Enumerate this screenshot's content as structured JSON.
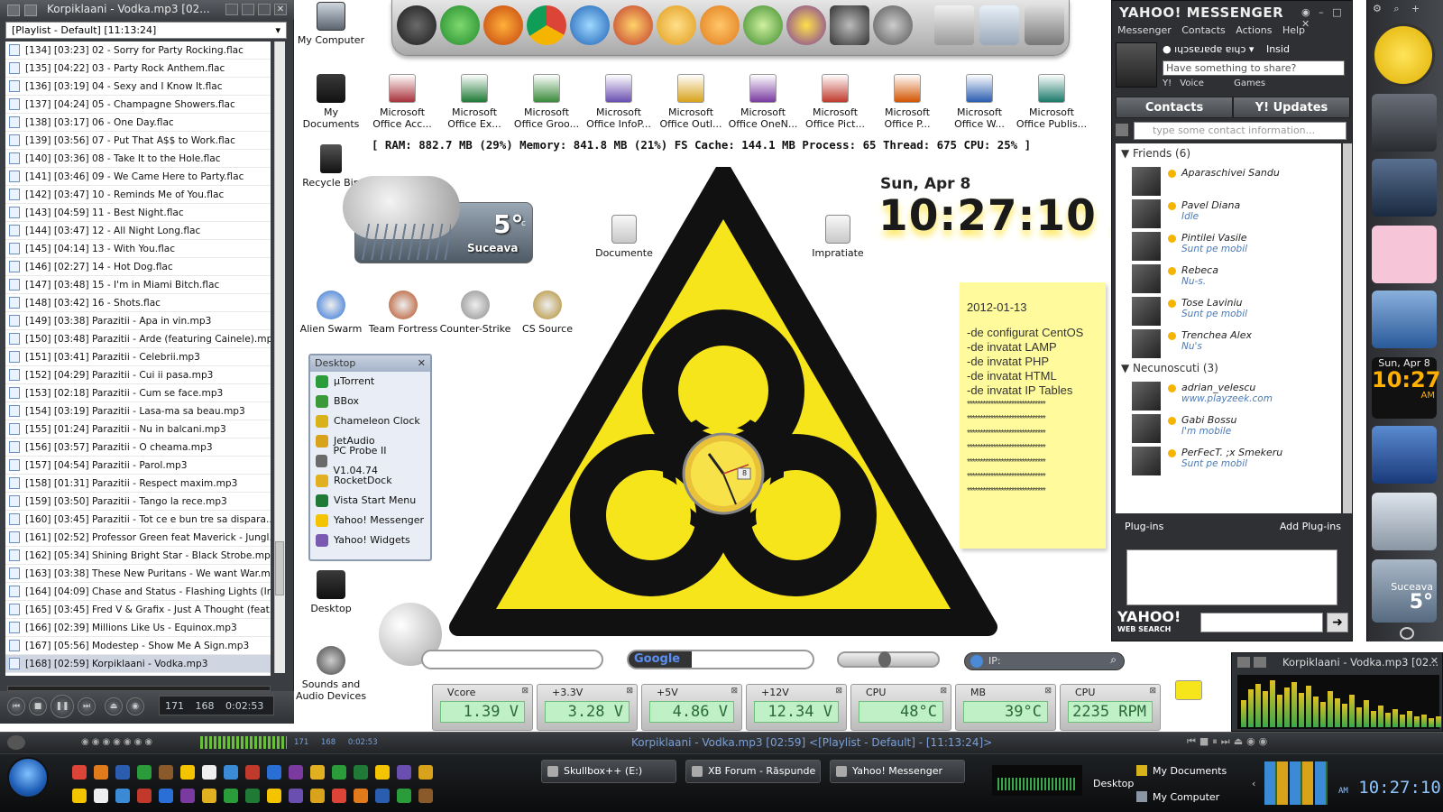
{
  "winamp": {
    "title": "Korpiklaani - Vodka.mp3 [02...",
    "playlist_name": "[Playlist - Default] [11:13:24]",
    "tracks": [
      "[134] [03:23] 02 - Sorry for Party Rocking.flac",
      "[135] [04:22] 03 - Party Rock Anthem.flac",
      "[136] [03:19] 04 - Sexy and I Know It.flac",
      "[137] [04:24] 05 - Champagne Showers.flac",
      "[138] [03:17] 06 - One Day.flac",
      "[139] [03:56] 07 - Put That A$$ to Work.flac",
      "[140] [03:36] 08 - Take It to the Hole.flac",
      "[141] [03:46] 09 - We Came Here to Party.flac",
      "[142] [03:47] 10 - Reminds Me of You.flac",
      "[143] [04:59] 11 - Best Night.flac",
      "[144] [03:47] 12 - All Night Long.flac",
      "[145] [04:14] 13 - With You.flac",
      "[146] [02:27] 14 - Hot Dog.flac",
      "[147] [03:48] 15 - I'm in Miami Bitch.flac",
      "[148] [03:42] 16 - Shots.flac",
      "[149] [03:38] Parazitii - Apa in vin.mp3",
      "[150] [03:48] Parazitii - Arde (featuring Cainele).mp3",
      "[151] [03:41] Parazitii - Celebrii.mp3",
      "[152] [04:29] Parazitii - Cui ii pasa.mp3",
      "[153] [02:18] Parazitii - Cum se face.mp3",
      "[154] [03:19] Parazitii - Lasa-ma sa beau.mp3",
      "[155] [01:24] Parazitii - Nu in balcani.mp3",
      "[156] [03:57] Parazitii - O cheama.mp3",
      "[157] [04:54] Parazitii - Parol.mp3",
      "[158] [01:31] Parazitii - Respect maxim.mp3",
      "[159] [03:50] Parazitii - Tango la rece.mp3",
      "[160] [03:45] Parazitii - Tot ce e bun tre sa dispara....",
      "[161] [02:52] Professor Green feat Maverick - Jungl...",
      "[162] [05:34] Shining Bright Star - Black Strobe.mp3",
      "[163] [03:38] These New Puritans - We want War.mp3",
      "[164] [04:09] Chase and Status - Flashing Lights (In...",
      "[165] [03:45] Fred V & Grafix - Just A Thought (feat...",
      "[166] [02:39] Millions Like Us - Equinox.mp3",
      "[167] [05:56] Modestep - Show Me A Sign.mp3",
      "[168] [02:59] Korpiklaani - Vodka.mp3"
    ],
    "counter": "171 168 0:02:53"
  },
  "desktop_icons_left": [
    {
      "label": "My Computer",
      "icon": "computer-icon"
    },
    {
      "label": "My Documents",
      "icon": "folder-icon"
    },
    {
      "label": "Recycle Bin",
      "icon": "recycle-bin-icon"
    }
  ],
  "game_icons": [
    {
      "label": "Alien Swarm",
      "color": "#2a6fd6"
    },
    {
      "label": "Team Fortress",
      "color": "#b24a1c"
    },
    {
      "label": "Counter-Strike",
      "color": "#8a8a8a"
    },
    {
      "label": "CS Source",
      "color": "#b08a2a"
    }
  ],
  "office_icons": [
    {
      "label": "Microsoft Office Acc...",
      "color": "#a8323a"
    },
    {
      "label": "Microsoft Office Ex...",
      "color": "#1f7a35"
    },
    {
      "label": "Microsoft Office Groo...",
      "color": "#3a8a3a"
    },
    {
      "label": "Microsoft Office InfoP...",
      "color": "#6a4fb0"
    },
    {
      "label": "Microsoft Office Outl...",
      "color": "#d8a21a"
    },
    {
      "label": "Microsoft Office OneN...",
      "color": "#7a3aa0"
    },
    {
      "label": "Microsoft Office Pict...",
      "color": "#c0392b"
    },
    {
      "label": "Microsoft Office P...",
      "color": "#d35400"
    },
    {
      "label": "Microsoft Office W...",
      "color": "#2a5db0"
    },
    {
      "label": "Microsoft Office Publis...",
      "color": "#1a7a6a"
    }
  ],
  "sysinfo": "[ RAM: 882.7 MB (29%)   Memory: 841.8 MB (21%)   FS Cache: 144.1 MB   Process: 65   Thread: 675   CPU: 25% ]",
  "weather": {
    "temp": "5°",
    "unit": "c",
    "city": "Suceava"
  },
  "desktop_files": [
    {
      "label": "Documente"
    },
    {
      "label": "Impratiate"
    }
  ],
  "clock": {
    "date": "Sun, Apr 8",
    "time": "10:27:10",
    "ampm": "AM",
    "badge": "8"
  },
  "note": {
    "date": "2012-01-13",
    "lines": [
      "-de configurat CentOS",
      "-de invatat LAMP",
      "-de invatat PHP",
      "-de invatat HTML",
      "-de invatat IP Tables"
    ],
    "stars": "******************************"
  },
  "desktop_menu": {
    "title": "Desktop",
    "items": [
      {
        "label": "µTorrent",
        "color": "#2a9d3a"
      },
      {
        "label": "BBox",
        "color": "#3a9a3a"
      },
      {
        "label": "Chameleon Clock",
        "color": "#d8b21a"
      },
      {
        "label": "JetAudio",
        "color": "#d8a21a"
      },
      {
        "label": "PC Probe II V1.04.74",
        "color": "#6a6a6a"
      },
      {
        "label": "RocketDock",
        "color": "#e0b020"
      },
      {
        "label": "Vista Start Menu",
        "color": "#1f7a35"
      },
      {
        "label": "Yahoo! Messenger",
        "color": "#f5c400"
      },
      {
        "label": "Yahoo! Widgets",
        "color": "#7a5ab0"
      }
    ]
  },
  "desktop_icon_desktop": "Desktop",
  "sounds_icon": "Sounds and Audio Devices",
  "search": {
    "google_label": "Google",
    "ip_label": "IP:"
  },
  "sensors": [
    {
      "label": "Vcore",
      "value": "1.39 V"
    },
    {
      "label": "+3.3V",
      "value": "3.28 V"
    },
    {
      "label": "+5V",
      "value": "4.86 V"
    },
    {
      "label": "+12V",
      "value": "12.34 V"
    },
    {
      "label": "CPU",
      "value": "48°C"
    },
    {
      "label": "MB",
      "value": "39°C"
    },
    {
      "label": "CPU",
      "value": "2235 RPM"
    }
  ],
  "messenger": {
    "title": "YAHOO! MESSENGER",
    "menu": [
      "Messenger",
      "Contacts",
      "Actions",
      "Help"
    ],
    "status_name": "ıɥɔsɐɹɐdɐ ɐıɥɔ",
    "status_insid": "Insid",
    "share_placeholder": "Have something to share?",
    "voice": "Y! Voice",
    "games": "Games",
    "tab_contacts": "Contacts",
    "tab_updates": "Y! Updates",
    "search_placeholder": "type some contact information...",
    "groups": [
      {
        "name": "Friends (6)",
        "contacts": [
          {
            "name": "Aparaschivei Sandu",
            "status": ""
          },
          {
            "name": "Pavel Diana",
            "status": "Idle"
          },
          {
            "name": "Pintilei Vasile",
            "status": "Sunt pe mobil"
          },
          {
            "name": "Rebeca",
            "status": "Nu-s."
          },
          {
            "name": "Tose Laviniu",
            "status": "Sunt pe mobil"
          },
          {
            "name": "Trenchea Alex",
            "status": "Nu's"
          }
        ]
      },
      {
        "name": "Necunoscuti (3)",
        "contacts": [
          {
            "name": "adrian_velescu",
            "status": "www.playzeek.com"
          },
          {
            "name": "Gabi Bossu",
            "status": "I'm mobile"
          },
          {
            "name": "PerFecT. ;x Smekeru",
            "status": "Sunt pe mobil"
          }
        ]
      }
    ],
    "plugins": "Plug-ins",
    "add_plugins": "Add Plug-ins",
    "web_search": "YAHOO!",
    "web_search_sub": "WEB SEARCH"
  },
  "sidebar": {
    "date": "Sun, Apr 8",
    "time": "10:27",
    "ampm": "AM",
    "city": "Suceava",
    "temp": "5°"
  },
  "mini_winamp": {
    "title": "Korpiklaani - Vodka.mp3 [02..."
  },
  "winamp_bar": {
    "title": "Korpiklaani - Vodka.mp3 [02:59]     <[Playlist - Default] - [11:13:24]>",
    "counters": "171 168 0:02:53"
  },
  "taskbar": {
    "tasks": [
      {
        "label": "Skullbox++ (E:)"
      },
      {
        "label": "XB Forum - Răspunde ..."
      },
      {
        "label": "Yahoo! Messenger"
      }
    ],
    "desktop": "Desktop",
    "my_documents": "My Documents",
    "my_computer": "My Computer",
    "clock": "10:27:10",
    "clock_ampm": "AM"
  }
}
